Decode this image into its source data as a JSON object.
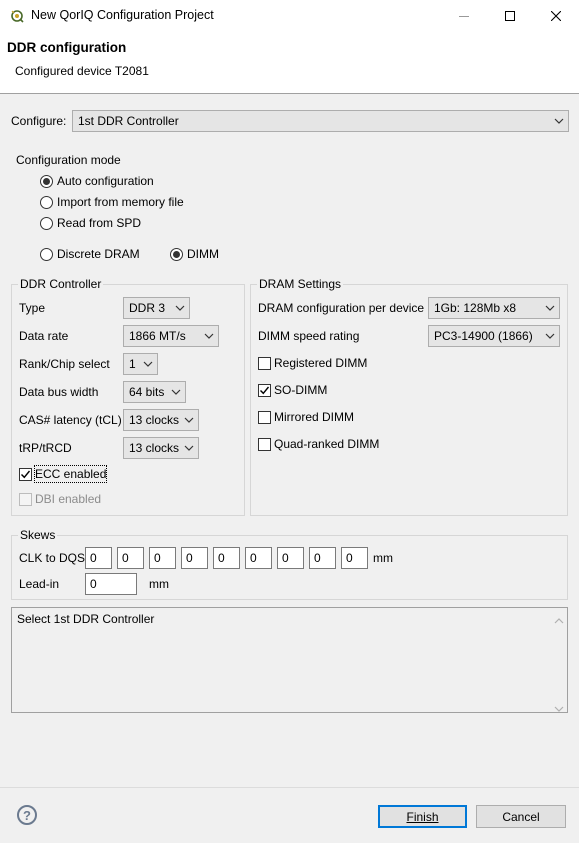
{
  "window": {
    "title": "New QorIQ Configuration Project"
  },
  "header": {
    "title": "DDR configuration",
    "subtitle": "Configured device T2081"
  },
  "configure": {
    "label": "Configure:",
    "value": "1st DDR Controller"
  },
  "mode": {
    "label": "Configuration mode",
    "options": [
      "Auto configuration",
      "Import from memory file",
      "Read from SPD"
    ],
    "selected": "Auto configuration",
    "memory_types": [
      "Discrete DRAM",
      "DIMM"
    ],
    "memory_selected": "DIMM"
  },
  "ddr_controller": {
    "label": "DDR Controller",
    "fields": [
      {
        "label": "Type",
        "value": "DDR 3"
      },
      {
        "label": "Data rate",
        "value": "1866 MT/s"
      },
      {
        "label": "Rank/Chip select",
        "value": "1"
      },
      {
        "label": "Data bus width",
        "value": "64 bits"
      },
      {
        "label": "CAS# latency (tCL)",
        "value": "13 clocks"
      },
      {
        "label": "tRP/tRCD",
        "value": "13 clocks"
      }
    ],
    "ecc_label": "ECC enabled",
    "ecc_checked": true,
    "dbi_label": "DBI enabled",
    "dbi_checked": false
  },
  "dram_settings": {
    "label": "DRAM Settings",
    "fields": [
      {
        "label": "DRAM configuration per device",
        "value": "1Gb: 128Mb x8"
      },
      {
        "label": "DIMM speed rating",
        "value": "PC3-14900 (1866)"
      }
    ],
    "checks": [
      {
        "label": "Registered DIMM",
        "checked": false
      },
      {
        "label": "SO-DIMM",
        "checked": true
      },
      {
        "label": "Mirrored DIMM",
        "checked": false
      },
      {
        "label": "Quad-ranked DIMM",
        "checked": false
      }
    ]
  },
  "skews": {
    "label": "Skews",
    "clk_label": "CLK to DQS",
    "clk_values": [
      "0",
      "0",
      "0",
      "0",
      "0",
      "0",
      "0",
      "0",
      "0"
    ],
    "unit": "mm",
    "leadin_label": "Lead-in",
    "leadin_value": "0",
    "leadin_unit": "mm"
  },
  "message": {
    "text": "Select 1st DDR Controller"
  },
  "buttons": {
    "finish": "Finish",
    "cancel": "Cancel"
  },
  "icons": {
    "app": "qoriq-app-icon",
    "minimize": "minimize-icon",
    "maximize": "maximize-icon",
    "close": "close-icon",
    "help": "help-icon",
    "dropdown": "chevron-down-icon"
  },
  "colors": {
    "default_button_border": "#0078d7",
    "background": "#f0f0f0"
  }
}
